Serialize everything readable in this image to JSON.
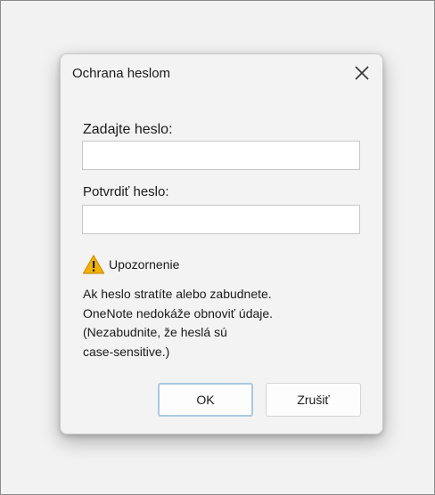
{
  "dialog": {
    "title": "Ochrana heslom",
    "close_icon": "close-icon"
  },
  "fields": {
    "enter_label": "Zadajte heslo:",
    "enter_value": "",
    "confirm_label": "Potvrdiť heslo:",
    "confirm_value": ""
  },
  "warning": {
    "icon": "warning-triangle-icon",
    "icon_color": "#f2b300",
    "title": "Upozornenie",
    "lines": [
      "Ak heslo stratíte alebo zabudnete.",
      "OneNote nedokáže obnoviť údaje.",
      "(Nezabudnite, že heslá sú",
      "case-sensitive.)"
    ]
  },
  "buttons": {
    "ok_label": "OK",
    "cancel_label": "Zrušiť"
  },
  "colors": {
    "ok_border": "#aac8df",
    "background": "#f3f3f3"
  }
}
